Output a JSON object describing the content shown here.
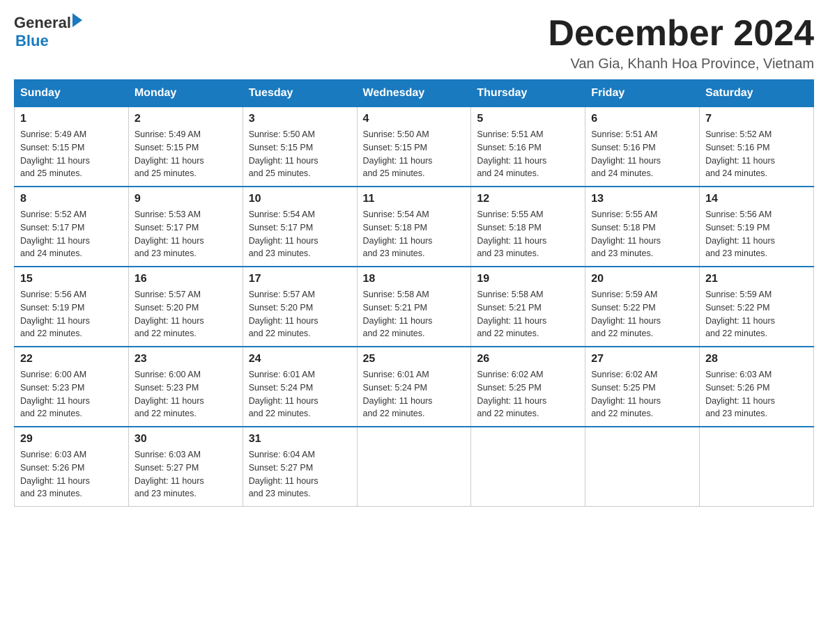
{
  "header": {
    "logo_general": "General",
    "logo_blue": "Blue",
    "month_title": "December 2024",
    "location": "Van Gia, Khanh Hoa Province, Vietnam"
  },
  "days_of_week": [
    "Sunday",
    "Monday",
    "Tuesday",
    "Wednesday",
    "Thursday",
    "Friday",
    "Saturday"
  ],
  "weeks": [
    [
      {
        "day": "1",
        "sunrise": "5:49 AM",
        "sunset": "5:15 PM",
        "daylight": "11 hours and 25 minutes."
      },
      {
        "day": "2",
        "sunrise": "5:49 AM",
        "sunset": "5:15 PM",
        "daylight": "11 hours and 25 minutes."
      },
      {
        "day": "3",
        "sunrise": "5:50 AM",
        "sunset": "5:15 PM",
        "daylight": "11 hours and 25 minutes."
      },
      {
        "day": "4",
        "sunrise": "5:50 AM",
        "sunset": "5:15 PM",
        "daylight": "11 hours and 25 minutes."
      },
      {
        "day": "5",
        "sunrise": "5:51 AM",
        "sunset": "5:16 PM",
        "daylight": "11 hours and 24 minutes."
      },
      {
        "day": "6",
        "sunrise": "5:51 AM",
        "sunset": "5:16 PM",
        "daylight": "11 hours and 24 minutes."
      },
      {
        "day": "7",
        "sunrise": "5:52 AM",
        "sunset": "5:16 PM",
        "daylight": "11 hours and 24 minutes."
      }
    ],
    [
      {
        "day": "8",
        "sunrise": "5:52 AM",
        "sunset": "5:17 PM",
        "daylight": "11 hours and 24 minutes."
      },
      {
        "day": "9",
        "sunrise": "5:53 AM",
        "sunset": "5:17 PM",
        "daylight": "11 hours and 23 minutes."
      },
      {
        "day": "10",
        "sunrise": "5:54 AM",
        "sunset": "5:17 PM",
        "daylight": "11 hours and 23 minutes."
      },
      {
        "day": "11",
        "sunrise": "5:54 AM",
        "sunset": "5:18 PM",
        "daylight": "11 hours and 23 minutes."
      },
      {
        "day": "12",
        "sunrise": "5:55 AM",
        "sunset": "5:18 PM",
        "daylight": "11 hours and 23 minutes."
      },
      {
        "day": "13",
        "sunrise": "5:55 AM",
        "sunset": "5:18 PM",
        "daylight": "11 hours and 23 minutes."
      },
      {
        "day": "14",
        "sunrise": "5:56 AM",
        "sunset": "5:19 PM",
        "daylight": "11 hours and 23 minutes."
      }
    ],
    [
      {
        "day": "15",
        "sunrise": "5:56 AM",
        "sunset": "5:19 PM",
        "daylight": "11 hours and 22 minutes."
      },
      {
        "day": "16",
        "sunrise": "5:57 AM",
        "sunset": "5:20 PM",
        "daylight": "11 hours and 22 minutes."
      },
      {
        "day": "17",
        "sunrise": "5:57 AM",
        "sunset": "5:20 PM",
        "daylight": "11 hours and 22 minutes."
      },
      {
        "day": "18",
        "sunrise": "5:58 AM",
        "sunset": "5:21 PM",
        "daylight": "11 hours and 22 minutes."
      },
      {
        "day": "19",
        "sunrise": "5:58 AM",
        "sunset": "5:21 PM",
        "daylight": "11 hours and 22 minutes."
      },
      {
        "day": "20",
        "sunrise": "5:59 AM",
        "sunset": "5:22 PM",
        "daylight": "11 hours and 22 minutes."
      },
      {
        "day": "21",
        "sunrise": "5:59 AM",
        "sunset": "5:22 PM",
        "daylight": "11 hours and 22 minutes."
      }
    ],
    [
      {
        "day": "22",
        "sunrise": "6:00 AM",
        "sunset": "5:23 PM",
        "daylight": "11 hours and 22 minutes."
      },
      {
        "day": "23",
        "sunrise": "6:00 AM",
        "sunset": "5:23 PM",
        "daylight": "11 hours and 22 minutes."
      },
      {
        "day": "24",
        "sunrise": "6:01 AM",
        "sunset": "5:24 PM",
        "daylight": "11 hours and 22 minutes."
      },
      {
        "day": "25",
        "sunrise": "6:01 AM",
        "sunset": "5:24 PM",
        "daylight": "11 hours and 22 minutes."
      },
      {
        "day": "26",
        "sunrise": "6:02 AM",
        "sunset": "5:25 PM",
        "daylight": "11 hours and 22 minutes."
      },
      {
        "day": "27",
        "sunrise": "6:02 AM",
        "sunset": "5:25 PM",
        "daylight": "11 hours and 22 minutes."
      },
      {
        "day": "28",
        "sunrise": "6:03 AM",
        "sunset": "5:26 PM",
        "daylight": "11 hours and 23 minutes."
      }
    ],
    [
      {
        "day": "29",
        "sunrise": "6:03 AM",
        "sunset": "5:26 PM",
        "daylight": "11 hours and 23 minutes."
      },
      {
        "day": "30",
        "sunrise": "6:03 AM",
        "sunset": "5:27 PM",
        "daylight": "11 hours and 23 minutes."
      },
      {
        "day": "31",
        "sunrise": "6:04 AM",
        "sunset": "5:27 PM",
        "daylight": "11 hours and 23 minutes."
      },
      null,
      null,
      null,
      null
    ]
  ],
  "labels": {
    "sunrise": "Sunrise:",
    "sunset": "Sunset:",
    "daylight": "Daylight:"
  }
}
